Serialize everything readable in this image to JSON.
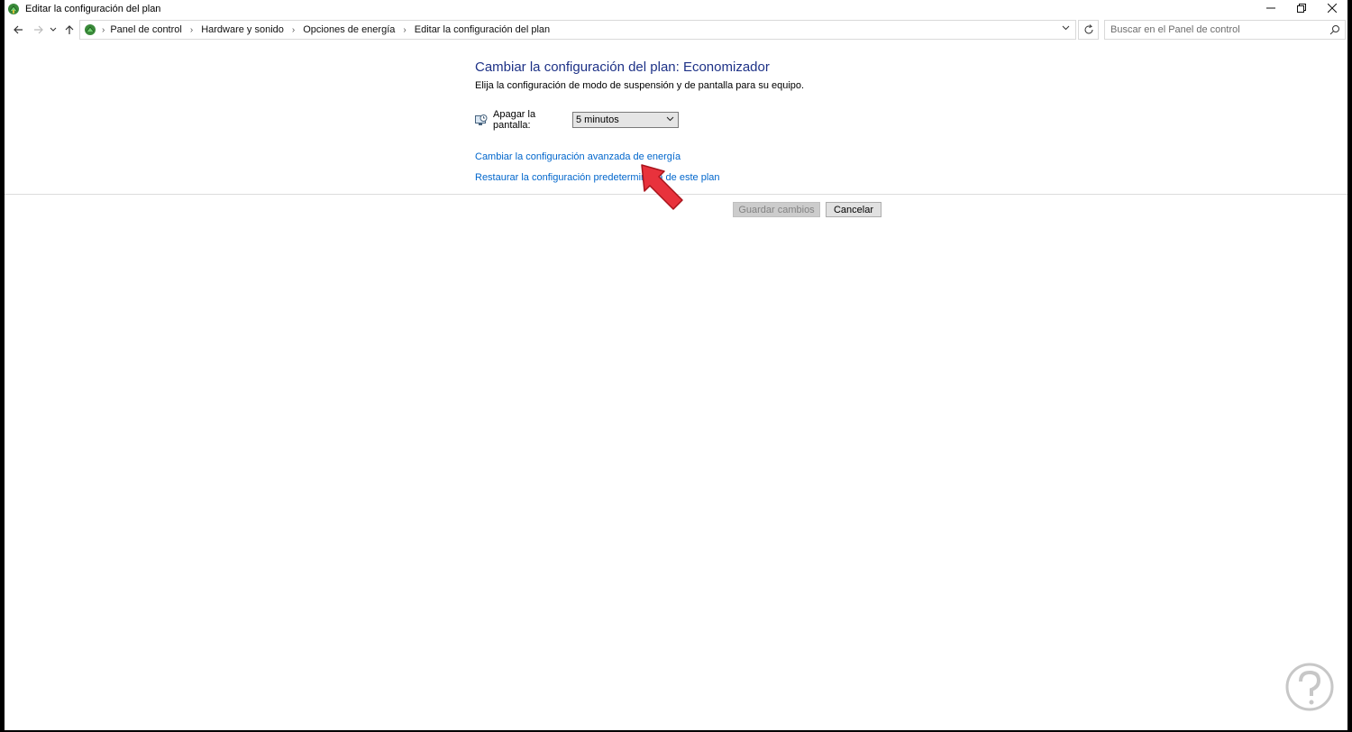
{
  "window": {
    "title": "Editar la configuración del plan",
    "controls": [
      "minimize",
      "restore",
      "close"
    ]
  },
  "address_bar": {
    "breadcrumbs": [
      "Panel de control",
      "Hardware y sonido",
      "Opciones de energía",
      "Editar la configuración del plan"
    ],
    "search_placeholder": "Buscar en el Panel de control"
  },
  "main": {
    "heading": "Cambiar la configuración del plan: Economizador",
    "subheading": "Elija la configuración de modo de suspensión y de pantalla para su equipo.",
    "setting": {
      "label": "Apagar la pantalla:",
      "value": "5 minutos"
    },
    "links": {
      "advanced": "Cambiar la configuración avanzada de energía",
      "restore": "Restaurar la configuración predeterminada de este plan"
    },
    "buttons": {
      "save": "Guardar cambios",
      "cancel": "Cancelar"
    }
  },
  "colors": {
    "heading": "#1e3287",
    "link": "#0066cc",
    "pointer": "#e8323c"
  },
  "icons": [
    "power-options-icon",
    "back-icon",
    "forward-icon",
    "recent-locations-icon",
    "up-icon",
    "refresh-icon",
    "search-icon",
    "monitor-clock-icon",
    "pointer-hand-icon"
  ]
}
